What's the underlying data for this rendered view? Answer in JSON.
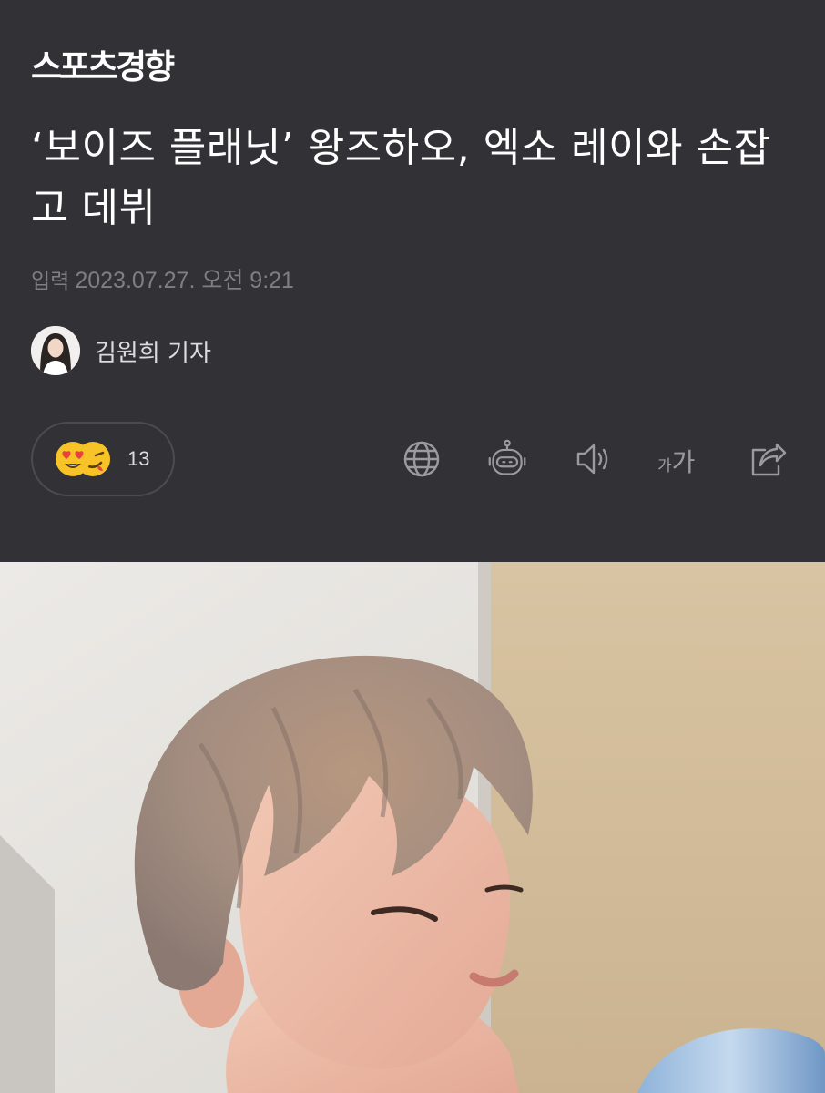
{
  "brand": {
    "logo_text": "스포츠경향"
  },
  "article": {
    "headline": "‘보이즈 플래닛’ 왕즈하오, 엑소 레이와 손잡고 데뷔",
    "published_label": "입력",
    "published_datetime": "2023.07.27. 오전 9:21",
    "reporter": "김원희 기자"
  },
  "reactions": {
    "count": "13",
    "emojis": [
      "heart-eyes-emoji",
      "winking-tongue-emoji"
    ]
  },
  "toolbar": {
    "icons": [
      "globe-icon",
      "robot-icon",
      "speaker-icon",
      "font-size-icon",
      "share-icon"
    ],
    "font_size_small": "가",
    "font_size_large": "가"
  },
  "colors": {
    "header_bg": "#323236",
    "text_primary": "#ffffff",
    "text_meta": "#7e7e83",
    "icon_gray": "#9a9aa0",
    "emoji_yellow": "#f7c326"
  }
}
